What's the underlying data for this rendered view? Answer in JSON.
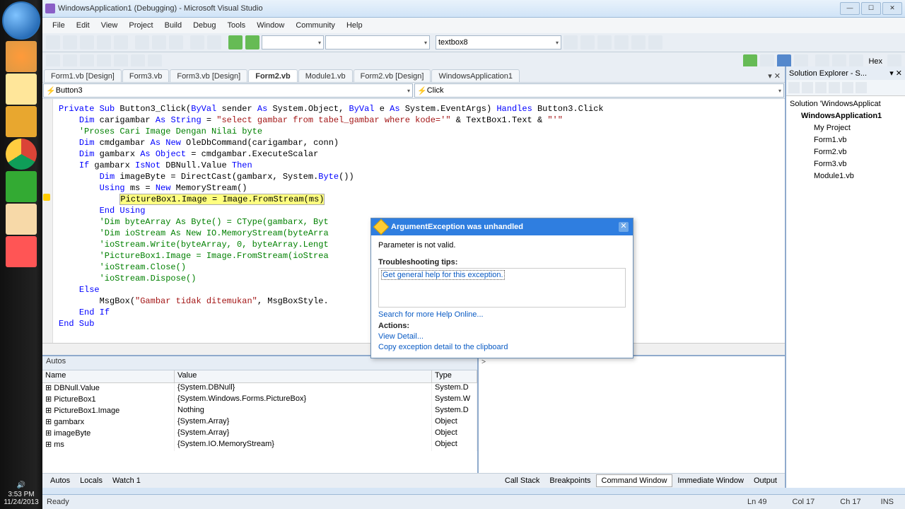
{
  "window": {
    "title": "WindowsApplication1 (Debugging) - Microsoft Visual Studio"
  },
  "menu": [
    "File",
    "Edit",
    "View",
    "Project",
    "Build",
    "Debug",
    "Tools",
    "Window",
    "Community",
    "Help"
  ],
  "toolbar2": {
    "find_combo": "textbox8"
  },
  "tabs": [
    "Form1.vb [Design]",
    "Form3.vb",
    "Form3.vb [Design]",
    "Form2.vb",
    "Module1.vb",
    "Form2.vb [Design]",
    "WindowsApplication1"
  ],
  "active_tab": "Form2.vb",
  "nav": {
    "left": "Button3",
    "right": "Click"
  },
  "code": {
    "l1a": "Private Sub",
    " l1b": " Button3_Click(",
    "l1c": "ByVal",
    "l1d": " sender ",
    "l1e": "As",
    "l1f": " System.Object, ",
    "l1g": "ByVal",
    "l1h": " e ",
    "l1i": "As",
    "l1j": " System.EventArgs) ",
    "l1k": "Handles",
    "l1l": " Button3.Click",
    "l2a": "Dim",
    "l2b": " carigambar ",
    "l2c": "As String",
    "l2d": " = ",
    "l2e": "\"select gambar from tabel_gambar where kode='\"",
    "l2f": " & TextBox1.Text & ",
    "l2g": "\"'\"",
    "l3": "'Proses Cari Image Dengan Nilai byte",
    "l4a": "Dim",
    "l4b": " cmdgambar ",
    "l4c": "As New",
    "l4d": " OleDbCommand(carigambar, conn)",
    "l5a": "Dim",
    "l5b": " gambarx ",
    "l5c": "As Object",
    "l5d": " = cmdgambar.ExecuteScalar",
    "l6a": "If",
    "l6b": " gambarx ",
    "l6c": "IsNot",
    "l6d": " DBNull.Value ",
    "l6e": "Then",
    "l7a": "Dim",
    "l7b": " imageByte = DirectCast(gambarx, System.",
    "l7c": "Byte",
    "l7d": "())",
    "l8a": "Using",
    "l8b": " ms = ",
    "l8c": "New",
    "l8d": " MemoryStream()",
    "l9": "PictureBox1.Image = Image.FromStream(ms)",
    "l10": "End Using",
    "l11": "'Dim byteArray As Byte() = CType(gambarx, Byt",
    "l12": "'Dim ioStream As New IO.MemoryStream(byteArra",
    "l13": "'ioStream.Write(byteArray, 0, byteArray.Lengt",
    "l14": "'PictureBox1.Image = Image.FromStream(ioStrea",
    "l15": "'ioStream.Close()",
    "l16": "'ioStream.Dispose()",
    "l17": "Else",
    "l18a": "MsgBox(",
    "l18b": "\"Gambar tidak ditemukan\"",
    "l18c": ", MsgBoxStyle.",
    "l19": "End If",
    "l20": "End Sub"
  },
  "exception": {
    "title": "ArgumentException was unhandled",
    "message": "Parameter is not valid.",
    "tips_label": "Troubleshooting tips:",
    "tip_link": "Get general help for this exception.",
    "search_link": "Search for more Help Online...",
    "actions_label": "Actions:",
    "view_detail": "View Detail...",
    "copy": "Copy exception detail to the clipboard"
  },
  "autos": {
    "title": "Autos",
    "headers": {
      "name": "Name",
      "value": "Value",
      "type": "Type"
    },
    "rows": [
      {
        "name": "DBNull.Value",
        "value": "{System.DBNull}",
        "type": "System.D"
      },
      {
        "name": "PictureBox1",
        "value": "{System.Windows.Forms.PictureBox}",
        "type": "System.W"
      },
      {
        "name": "PictureBox1.Image",
        "value": "Nothing",
        "type": "System.D"
      },
      {
        "name": "gambarx",
        "value": "{System.Array}",
        "type": "Object"
      },
      {
        "name": "imageByte",
        "value": "{System.Array}",
        "type": "Object"
      },
      {
        "name": "ms",
        "value": "{System.IO.MemoryStream}",
        "type": "Object"
      }
    ]
  },
  "bottom_tabs_left": [
    "Autos",
    "Locals",
    "Watch 1"
  ],
  "bottom_tabs_right": [
    "Call Stack",
    "Breakpoints",
    "Command Window",
    "Immediate Window",
    "Output"
  ],
  "cmdwin_prompt": ">",
  "solution": {
    "panel": "Solution Explorer - S...",
    "root": "Solution 'WindowsApplicat",
    "proj": "WindowsApplication1",
    "items": [
      "My Project",
      "Form1.vb",
      "Form2.vb",
      "Form3.vb",
      "Module1.vb"
    ]
  },
  "status": {
    "ready": "Ready",
    "ln": "Ln 49",
    "col": "Col 17",
    "ch": "Ch 17",
    "ins": "INS"
  },
  "tray": {
    "time": "3:53 PM",
    "date": "11/24/2013"
  }
}
